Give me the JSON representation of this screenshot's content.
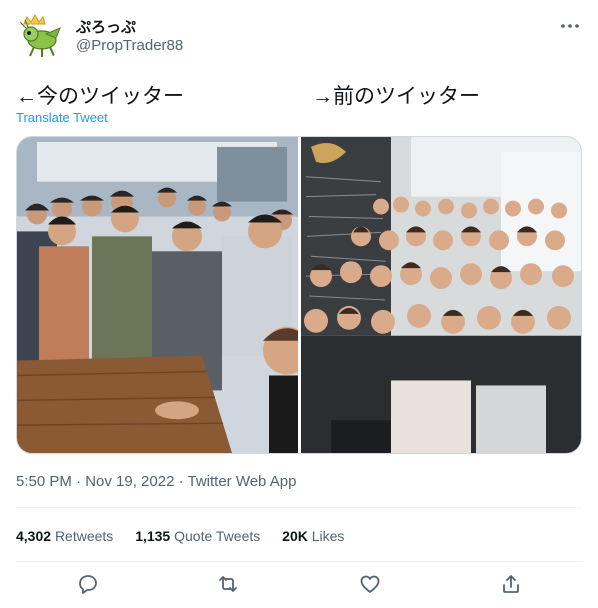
{
  "author": {
    "display_name": "ぷろっぷ",
    "handle": "@PropTrader88"
  },
  "tweet": {
    "text_left": "←今のツイッター",
    "text_right": "→前のツイッター",
    "translate_label": "Translate Tweet",
    "timestamp": "5:50 PM · Nov 19, 2022 · Twitter Web App"
  },
  "stats": {
    "retweets_count": "4,302",
    "retweets_label": "Retweets",
    "quotes_count": "1,135",
    "quotes_label": "Quote Tweets",
    "likes_count": "20K",
    "likes_label": "Likes"
  },
  "actions": [
    "reply-icon",
    "retweet-icon",
    "like-icon",
    "share-icon"
  ],
  "colors": {
    "accent": "#1d9bf0",
    "secondary_text": "#536471",
    "border": "#cfd9de"
  }
}
